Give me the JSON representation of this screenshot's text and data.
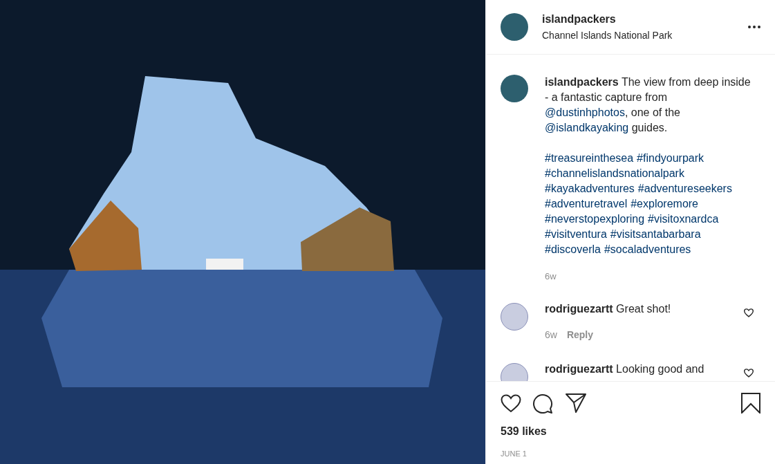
{
  "post": {
    "author": {
      "username": "islandpackers",
      "location": "Channel Islands National Park"
    },
    "caption": {
      "username": "islandpackers",
      "segments": [
        {
          "kind": "text",
          "text": "The view from deep inside - a fantastic capture from "
        },
        {
          "kind": "mention",
          "text": "@dustinhphotos"
        },
        {
          "kind": "text",
          "text": ", one of the "
        },
        {
          "kind": "mention",
          "text": "@islandkayaking"
        },
        {
          "kind": "text",
          "text": " guides."
        }
      ],
      "hashtags": [
        "#treasureinthesea",
        "#findyourpark",
        "#channelislandsnationalpark",
        "#kayakadventures",
        "#adventureseekers",
        "#adventuretravel",
        "#exploremore",
        "#neverstopexploring",
        "#visitoxnardca",
        "#visitventura",
        "#visitsantabarbara",
        "#discoverla",
        "#socaladventures"
      ],
      "time": "6w"
    },
    "comments": [
      {
        "username": "rodriguezartt",
        "text": "Great shot!",
        "time": "6w",
        "reply": "Reply",
        "liked": false
      },
      {
        "username": "rodriguezartt",
        "text": "Looking good and",
        "liked": false
      }
    ],
    "likes": "539 likes",
    "date": "JUNE 1"
  }
}
